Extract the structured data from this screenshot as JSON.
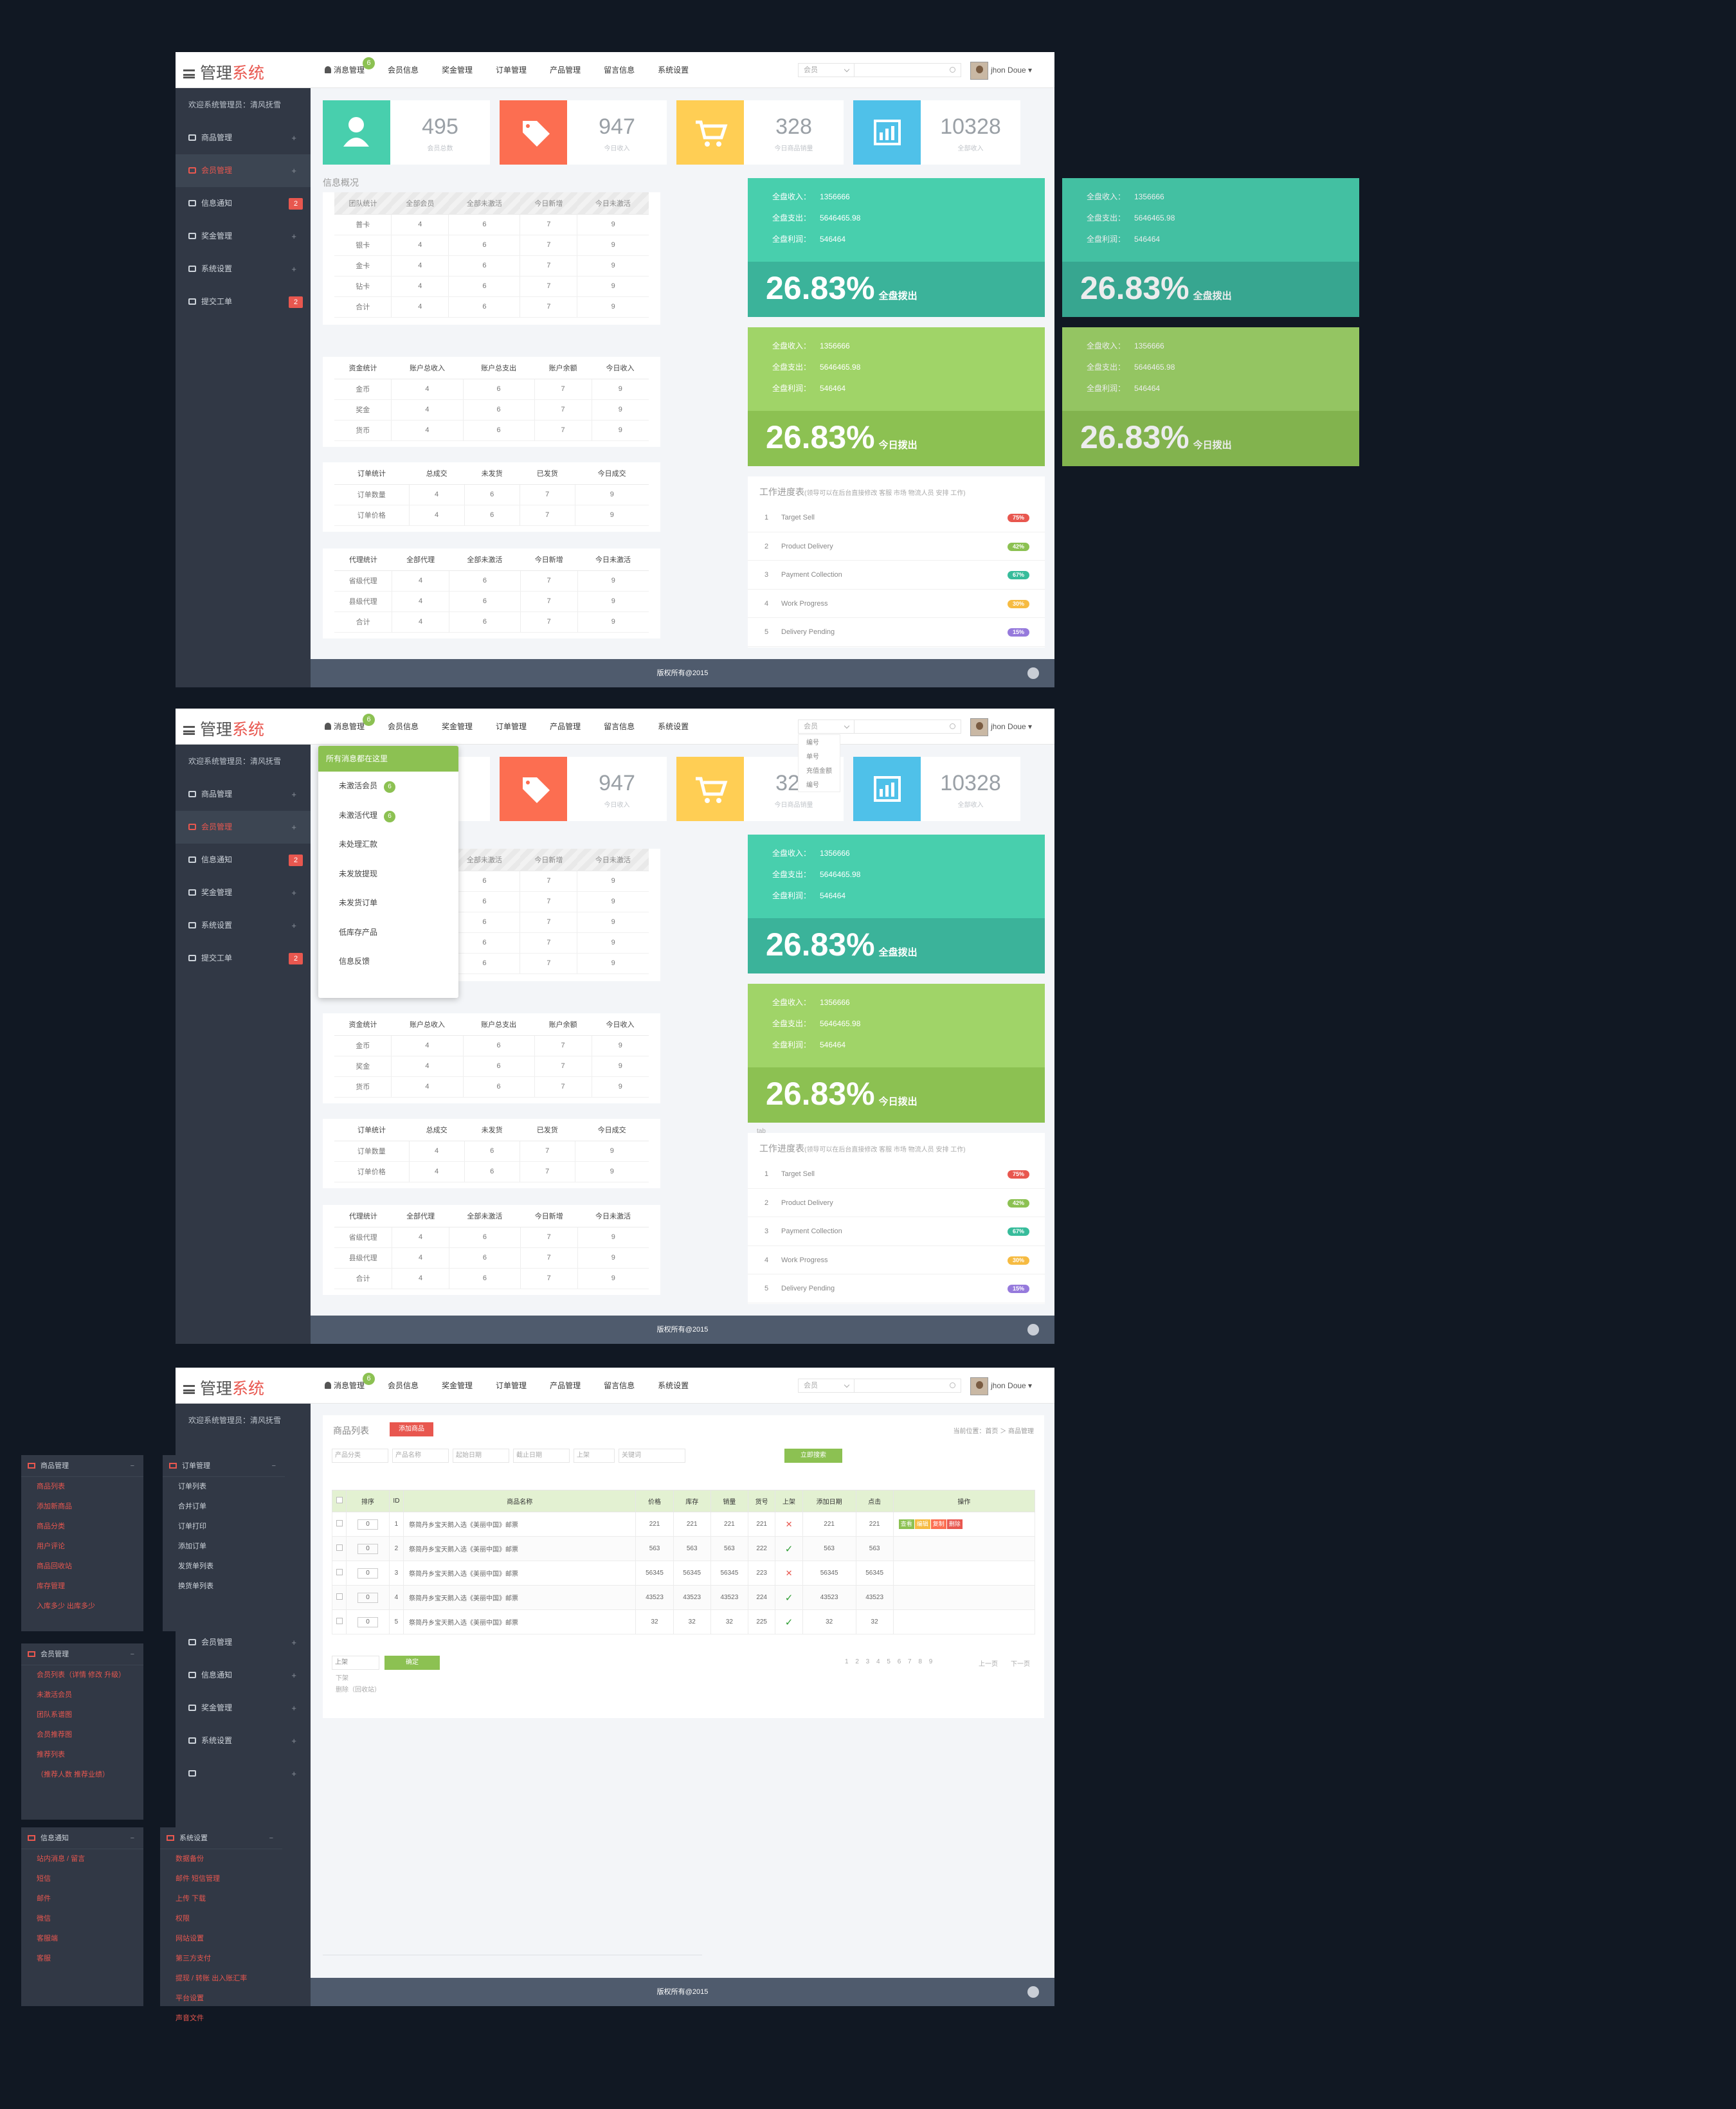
{
  "app": {
    "logo_a": "管理",
    "logo_b": "系统",
    "user_name": "jhon Doue ▾",
    "search_select": "会员",
    "footer": "版权所有@2015"
  },
  "nav": [
    {
      "label": "消息管理",
      "badge": "6"
    },
    {
      "label": "会员信息"
    },
    {
      "label": "奖金管理"
    },
    {
      "label": "订单管理"
    },
    {
      "label": "产品管理"
    },
    {
      "label": "留言信息"
    },
    {
      "label": "系统设置"
    }
  ],
  "sidebar": {
    "welcome": "欢迎系统管理员：清风抚雪",
    "items": [
      {
        "label": "商品管理",
        "badge": ""
      },
      {
        "label": "会员管理",
        "badge": ""
      },
      {
        "label": "信息通知",
        "badge": "2"
      },
      {
        "label": "奖金管理",
        "badge": ""
      },
      {
        "label": "系统设置",
        "badge": ""
      },
      {
        "label": "提交工单",
        "badge": "2"
      }
    ]
  },
  "stats": [
    {
      "value": "495",
      "label": "会员总数",
      "color": "#48cfad"
    },
    {
      "value": "947",
      "label": "今日收入",
      "color": "#fc6e51"
    },
    {
      "value": "328",
      "label": "今日商品销量",
      "color": "#ffce54"
    },
    {
      "value": "10328",
      "label": "全部收入",
      "color": "#4fc1e9"
    }
  ],
  "info_title": "信息概况",
  "team_table": {
    "headers": [
      "团队统计",
      "全部会员",
      "全部未激活",
      "今日新增",
      "今日未激活"
    ],
    "rows": [
      [
        "普卡",
        "4",
        "6",
        "7",
        "9"
      ],
      [
        "银卡",
        "4",
        "6",
        "7",
        "9"
      ],
      [
        "金卡",
        "4",
        "6",
        "7",
        "9"
      ],
      [
        "钻卡",
        "4",
        "6",
        "7",
        "9"
      ],
      [
        "合计",
        "4",
        "6",
        "7",
        "9"
      ]
    ]
  },
  "fund_table": {
    "headers": [
      "资金统计",
      "账户总收入",
      "账户总支出",
      "账户余额",
      "今日收入"
    ],
    "rows": [
      [
        "金币",
        "4",
        "6",
        "7",
        "9"
      ],
      [
        "奖金",
        "4",
        "6",
        "7",
        "9"
      ],
      [
        "货币",
        "4",
        "6",
        "7",
        "9"
      ]
    ]
  },
  "order_table": {
    "headers": [
      "订单统计",
      "总成交",
      "未发货",
      "已发货",
      "今日成交"
    ],
    "rows": [
      [
        "订单数量",
        "4",
        "6",
        "7",
        "9"
      ],
      [
        "订单价格",
        "4",
        "6",
        "7",
        "9"
      ]
    ]
  },
  "agent_table": {
    "headers": [
      "代理统计",
      "全部代理",
      "全部未激活",
      "今日新增",
      "今日未激活"
    ],
    "rows": [
      [
        "省级代理",
        "4",
        "6",
        "7",
        "9"
      ],
      [
        "县级代理",
        "4",
        "6",
        "7",
        "9"
      ],
      [
        "合计",
        "4",
        "6",
        "7",
        "9"
      ]
    ]
  },
  "finance": {
    "income_label": "全盘收入：",
    "income": "1356666",
    "expense_label": "全盘支出：",
    "expense": "5646465.98",
    "profit_label": "全盘利润：",
    "profit": "546464",
    "pct": "26.83%",
    "pct_total_label": "全盘拨出",
    "pct_today_label": "今日拨出"
  },
  "progress": {
    "title": "工作进度表",
    "note": "(领导可以在后台直接修改 客服 市场 物流人员 安排 工作)",
    "items": [
      {
        "n": "1",
        "label": "Target Sell",
        "pct": "75%",
        "color": "#e8574f"
      },
      {
        "n": "2",
        "label": "Product Delivery",
        "pct": "42%",
        "color": "#8cc152"
      },
      {
        "n": "3",
        "label": "Payment Collection",
        "pct": "67%",
        "color": "#37bc9b"
      },
      {
        "n": "4",
        "label": "Work Progress",
        "pct": "30%",
        "color": "#f6bb42"
      },
      {
        "n": "5",
        "label": "Delivery Pending",
        "pct": "15%",
        "color": "#967adc"
      }
    ]
  },
  "dropdown": {
    "header": "所有消息都在这里",
    "items": [
      {
        "label": "未激活会员",
        "badge": "6"
      },
      {
        "label": "未激活代理",
        "badge": "6"
      },
      {
        "label": "未处理汇款",
        "badge": ""
      },
      {
        "label": "未发放提现",
        "badge": ""
      },
      {
        "label": "未发货订单",
        "badge": ""
      },
      {
        "label": "低库存产品",
        "badge": ""
      },
      {
        "label": "信息反馈",
        "badge": ""
      }
    ]
  },
  "select_options": [
    "编号",
    "单号",
    "充值金额",
    "编号"
  ],
  "tab_hint": "tab",
  "product_list": {
    "title": "商品列表",
    "add_btn": "添加商品",
    "breadcrumb": "当前位置：首页 ＞ 商品管理",
    "filters": [
      "产品分类",
      "产品名称",
      "起始日期",
      "截止日期",
      "上架",
      "关键词"
    ],
    "search_btn": "立即搜索",
    "headers": [
      "",
      "排序",
      "ID",
      "商品名称",
      "价格",
      "库存",
      "销量",
      "货号",
      "上架",
      "添加日期",
      "点击",
      "操作"
    ],
    "rows": [
      {
        "order": "0",
        "id": "1",
        "name": "祭简丹乡宝天鹅入选《美丽中国》邮票",
        "price": "221",
        "stock": "221",
        "sales": "221",
        "sku": "221",
        "on": false,
        "date": "221",
        "clicks": "221"
      },
      {
        "order": "0",
        "id": "2",
        "name": "祭简丹乡宝天鹅入选《美丽中国》邮票",
        "price": "563",
        "stock": "563",
        "sales": "563",
        "sku": "222",
        "on": true,
        "date": "563",
        "clicks": "563"
      },
      {
        "order": "0",
        "id": "3",
        "name": "祭简丹乡宝天鹅入选《美丽中国》邮票",
        "price": "56345",
        "stock": "56345",
        "sales": "56345",
        "sku": "223",
        "on": false,
        "date": "56345",
        "clicks": "56345"
      },
      {
        "order": "0",
        "id": "4",
        "name": "祭简丹乡宝天鹅入选《美丽中国》邮票",
        "price": "43523",
        "stock": "43523",
        "sales": "43523",
        "sku": "224",
        "on": true,
        "date": "43523",
        "clicks": "43523"
      },
      {
        "order": "0",
        "id": "5",
        "name": "祭简丹乡宝天鹅入选《美丽中国》邮票",
        "price": "32",
        "stock": "32",
        "sales": "32",
        "sku": "225",
        "on": true,
        "date": "32",
        "clicks": "32"
      }
    ],
    "ops": [
      "查看",
      "编辑",
      "复制",
      "删除"
    ],
    "bulk_select": "上架",
    "bulk_btn": "确定",
    "bulk_opt1": "下架",
    "bulk_opt2": "删除（回收站）",
    "pages": "1 2 3 4 5 6 7 8 9",
    "prev": "上一页",
    "next": "下一页"
  },
  "menu_panels": {
    "goods": {
      "title": "商品管理",
      "items": [
        "商品列表",
        "添加新商品",
        "商品分类",
        "用户评论",
        "商品回收站",
        "库存管理",
        "入库多少  出库多少"
      ]
    },
    "orders": {
      "title": "订单管理",
      "items": [
        "订单列表",
        "合并订单",
        "订单打印",
        "添加订单",
        "发货单列表",
        "换货单列表"
      ]
    },
    "members": {
      "title": "会员管理",
      "items": [
        "会员列表（详情 修改 升级）",
        "未激活会员",
        "团队系谱图",
        "会员推荐图",
        "推荐列表",
        "（推荐人数 推荐业绩）"
      ]
    },
    "notice": {
      "title": "信息通知",
      "items": [
        "站内消息 / 留言",
        "短信",
        "邮件",
        "微信",
        "客服端",
        "客服"
      ]
    },
    "settings": {
      "title": "系统设置",
      "items": [
        "数据备份",
        "邮件 短信管理",
        "上传 下载",
        "权限",
        "网站设置",
        "第三方支付",
        "提现 / 转账 出入账汇率",
        "平台设置",
        "声音文件"
      ]
    }
  }
}
